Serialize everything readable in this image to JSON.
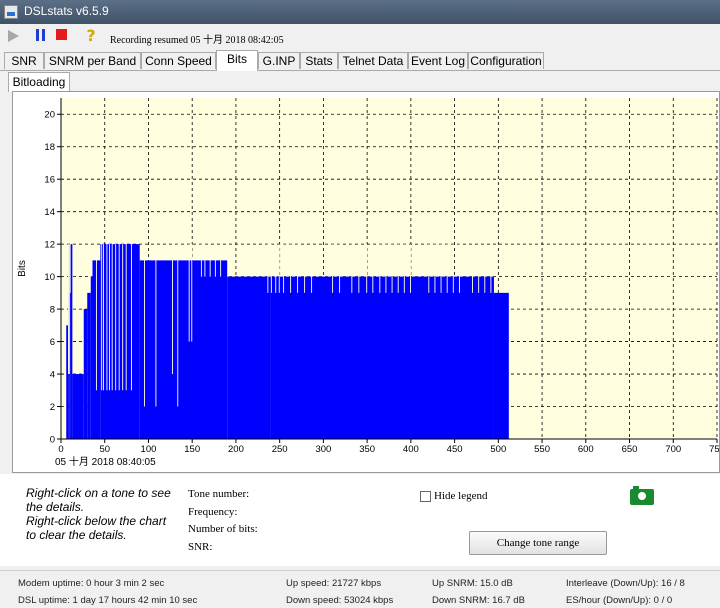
{
  "window": {
    "title": "DSLstats v6.5.9"
  },
  "toolbar": {
    "status": "Recording resumed 05 十月 2018 08:42:05",
    "icons": [
      "play-icon",
      "pause-icon",
      "stop-icon",
      "help-icon"
    ],
    "colors": {
      "pause": "#1c3fd3",
      "stop": "#e31b1b",
      "play": "#a7a7a7"
    }
  },
  "tabs": [
    "SNR",
    "SNRM per Band",
    "Conn Speed",
    "Bits",
    "G.INP",
    "Stats",
    "Telnet Data",
    "Event Log",
    "Configuration"
  ],
  "active_tab": "Bits",
  "subtab": "Bitloading",
  "chart_data": {
    "type": "bar",
    "ylabel": "Bits",
    "xlabel": "05 十月 2018 08:40:05",
    "xlim": [
      0,
      750
    ],
    "ylim": [
      0,
      21
    ],
    "x_ticks": [
      0,
      50,
      100,
      150,
      200,
      250,
      300,
      350,
      400,
      450,
      500,
      550,
      600,
      650,
      700,
      750
    ],
    "y_ticks": [
      0,
      2,
      4,
      6,
      8,
      10,
      12,
      14,
      16,
      18,
      20
    ],
    "grid": true,
    "background": "#ffffe0",
    "bar_color": "#0000ff",
    "segments": [
      {
        "from": 0,
        "to": 6,
        "value": 0
      },
      {
        "from": 6,
        "to": 8,
        "value": 7
      },
      {
        "from": 8,
        "to": 9,
        "value": 9
      },
      {
        "from": 9,
        "to": 10,
        "value": 12
      },
      {
        "from": 10,
        "to": 11,
        "value": 9
      },
      {
        "from": 11,
        "to": 13,
        "value": 12
      },
      {
        "from": 13,
        "to": 26,
        "value": 4
      },
      {
        "from": 26,
        "to": 30,
        "value": 8
      },
      {
        "from": 30,
        "to": 34,
        "value": 9
      },
      {
        "from": 34,
        "to": 36,
        "value": 10
      },
      {
        "from": 36,
        "to": 45,
        "value": 11
      },
      {
        "from": 45,
        "to": 90,
        "value": 12
      },
      {
        "from": 90,
        "to": 190,
        "value": 11
      },
      {
        "from": 190,
        "to": 240,
        "value": 10
      },
      {
        "from": 240,
        "to": 495,
        "value": 10
      },
      {
        "from": 495,
        "to": 512,
        "value": 9
      }
    ],
    "notches": [
      {
        "x": 8,
        "value": 4
      },
      {
        "x": 9,
        "value": 4
      },
      {
        "x": 40,
        "value": 3
      },
      {
        "x": 46,
        "value": 3
      },
      {
        "x": 48,
        "value": 3
      },
      {
        "x": 52,
        "value": 3
      },
      {
        "x": 55,
        "value": 3
      },
      {
        "x": 58,
        "value": 3
      },
      {
        "x": 62,
        "value": 3
      },
      {
        "x": 66,
        "value": 3
      },
      {
        "x": 70,
        "value": 3
      },
      {
        "x": 74,
        "value": 3
      },
      {
        "x": 80,
        "value": 3
      },
      {
        "x": 95,
        "value": 2
      },
      {
        "x": 108,
        "value": 2
      },
      {
        "x": 127,
        "value": 4
      },
      {
        "x": 133,
        "value": 2
      },
      {
        "x": 146,
        "value": 6
      },
      {
        "x": 149,
        "value": 6
      },
      {
        "x": 160,
        "value": 10
      },
      {
        "x": 164,
        "value": 10
      },
      {
        "x": 170,
        "value": 10
      },
      {
        "x": 176,
        "value": 10
      },
      {
        "x": 182,
        "value": 10
      },
      {
        "x": 236,
        "value": 9
      },
      {
        "x": 240,
        "value": 9
      },
      {
        "x": 245,
        "value": 9
      },
      {
        "x": 249,
        "value": 9
      },
      {
        "x": 254,
        "value": 9
      },
      {
        "x": 262,
        "value": 9
      },
      {
        "x": 270,
        "value": 9
      },
      {
        "x": 278,
        "value": 9
      },
      {
        "x": 286,
        "value": 9
      },
      {
        "x": 310,
        "value": 9
      },
      {
        "x": 318,
        "value": 9
      },
      {
        "x": 332,
        "value": 9
      },
      {
        "x": 340,
        "value": 9
      },
      {
        "x": 349,
        "value": 9
      },
      {
        "x": 356,
        "value": 9
      },
      {
        "x": 364,
        "value": 9
      },
      {
        "x": 371,
        "value": 9
      },
      {
        "x": 378,
        "value": 9
      },
      {
        "x": 385,
        "value": 9
      },
      {
        "x": 392,
        "value": 9
      },
      {
        "x": 399,
        "value": 9
      },
      {
        "x": 420,
        "value": 9
      },
      {
        "x": 427,
        "value": 9
      },
      {
        "x": 434,
        "value": 9
      },
      {
        "x": 441,
        "value": 9
      },
      {
        "x": 448,
        "value": 9
      },
      {
        "x": 455,
        "value": 9
      },
      {
        "x": 470,
        "value": 9
      },
      {
        "x": 477,
        "value": 9
      },
      {
        "x": 484,
        "value": 9
      },
      {
        "x": 491,
        "value": 9
      }
    ]
  },
  "details": {
    "hint": [
      "Right-click on a tone to see",
      "the details.",
      "Right-click below the chart",
      "to clear the details."
    ],
    "fields": [
      "Tone number:",
      "Frequency:",
      "Number of bits:",
      "SNR:"
    ],
    "hide_legend": "Hide legend",
    "change_range": "Change tone range"
  },
  "status": {
    "modem_uptime": "Modem uptime:  0 hour 3 min 2 sec",
    "dsl_uptime": "DSL uptime: 1 day 17 hours 42 min 10 sec",
    "up_speed": "Up speed: 21727 kbps",
    "down_speed": "Down speed: 53024 kbps",
    "up_snrm": "Up SNRM: 15.0 dB",
    "down_snrm": "Down SNRM: 16.7 dB",
    "interleave": "Interleave (Down/Up): 16 / 8",
    "es_hour": "ES/hour (Down/Up): 0 / 0"
  }
}
